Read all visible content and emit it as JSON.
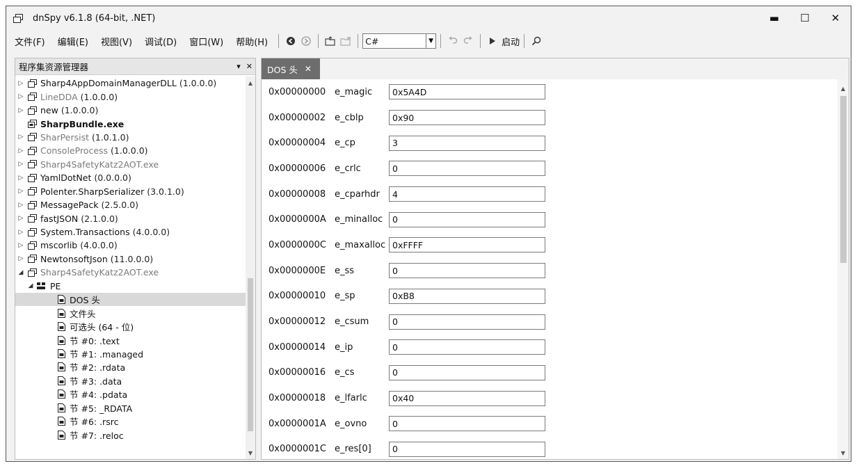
{
  "window": {
    "title": "dnSpy v6.1.8 (64-bit, .NET)",
    "controls": {
      "minimize": "▬",
      "maximize": "☐",
      "close": "✕"
    }
  },
  "menu": {
    "file": "文件(F)",
    "edit": "编辑(E)",
    "view": "视图(V)",
    "debug": "调试(D)",
    "window": "窗口(W)",
    "help": "帮助(H)"
  },
  "toolbar": {
    "language": "C#",
    "start_label": "启动"
  },
  "explorer": {
    "title": "程序集资源管理器",
    "dropdown_glyph": "▾",
    "close_glyph": "✕",
    "items": [
      {
        "label": "Sharp4AppDomainManagerDLL",
        "version": "(1.0.0.0)"
      },
      {
        "label": "LineDDA",
        "version": "(1.0.0.0)"
      },
      {
        "label": "new",
        "version": "(1.0.0.0)"
      },
      {
        "label": "SharpBundle.exe",
        "version": ""
      },
      {
        "label": "SharPersist",
        "version": "(1.0.1.0)"
      },
      {
        "label": "ConsoleProcess",
        "version": "(1.0.0.0)"
      },
      {
        "label": "Sharp4SafetyKatz2AOT.exe",
        "version": ""
      },
      {
        "label": "YamlDotNet",
        "version": "(0.0.0.0)"
      },
      {
        "label": "Polenter.SharpSerializer",
        "version": "(3.0.1.0)"
      },
      {
        "label": "MessagePack",
        "version": "(2.5.0.0)"
      },
      {
        "label": "fastJSON",
        "version": "(2.1.0.0)"
      },
      {
        "label": "System.Transactions",
        "version": "(4.0.0.0)"
      },
      {
        "label": "mscorlib",
        "version": "(4.0.0.0)"
      },
      {
        "label": "NewtonsoftJson",
        "version": "(11.0.0.0)"
      },
      {
        "label": "Sharp4SafetyKatz2AOT.exe",
        "version": ""
      },
      {
        "label": "PE",
        "version": ""
      },
      {
        "label": "DOS 头",
        "version": ""
      },
      {
        "label": "文件头",
        "version": ""
      },
      {
        "label": "可选头 (64 - 位)",
        "version": ""
      },
      {
        "label": "节 #0: .text",
        "version": ""
      },
      {
        "label": "节 #1: .managed",
        "version": ""
      },
      {
        "label": "节 #2: .rdata",
        "version": ""
      },
      {
        "label": "节 #3: .data",
        "version": ""
      },
      {
        "label": "节 #4: .pdata",
        "version": ""
      },
      {
        "label": "节 #5: _RDATA",
        "version": ""
      },
      {
        "label": "节 #6: .rsrc",
        "version": ""
      },
      {
        "label": "节 #7: .reloc",
        "version": ""
      }
    ]
  },
  "tab": {
    "label": "DOS 头",
    "close_glyph": "✕"
  },
  "dos_header": [
    {
      "offset": "0x00000000",
      "name": "e_magic",
      "value": "0x5A4D"
    },
    {
      "offset": "0x00000002",
      "name": "e_cblp",
      "value": "0x90"
    },
    {
      "offset": "0x00000004",
      "name": "e_cp",
      "value": "3"
    },
    {
      "offset": "0x00000006",
      "name": "e_crlc",
      "value": "0"
    },
    {
      "offset": "0x00000008",
      "name": "e_cparhdr",
      "value": "4"
    },
    {
      "offset": "0x0000000A",
      "name": "e_minalloc",
      "value": "0"
    },
    {
      "offset": "0x0000000C",
      "name": "e_maxalloc",
      "value": "0xFFFF"
    },
    {
      "offset": "0x0000000E",
      "name": "e_ss",
      "value": "0"
    },
    {
      "offset": "0x00000010",
      "name": "e_sp",
      "value": "0xB8"
    },
    {
      "offset": "0x00000012",
      "name": "e_csum",
      "value": "0"
    },
    {
      "offset": "0x00000014",
      "name": "e_ip",
      "value": "0"
    },
    {
      "offset": "0x00000016",
      "name": "e_cs",
      "value": "0"
    },
    {
      "offset": "0x00000018",
      "name": "e_lfarlc",
      "value": "0x40"
    },
    {
      "offset": "0x0000001A",
      "name": "e_ovno",
      "value": "0"
    },
    {
      "offset": "0x0000001C",
      "name": "e_res[0]",
      "value": "0"
    }
  ]
}
